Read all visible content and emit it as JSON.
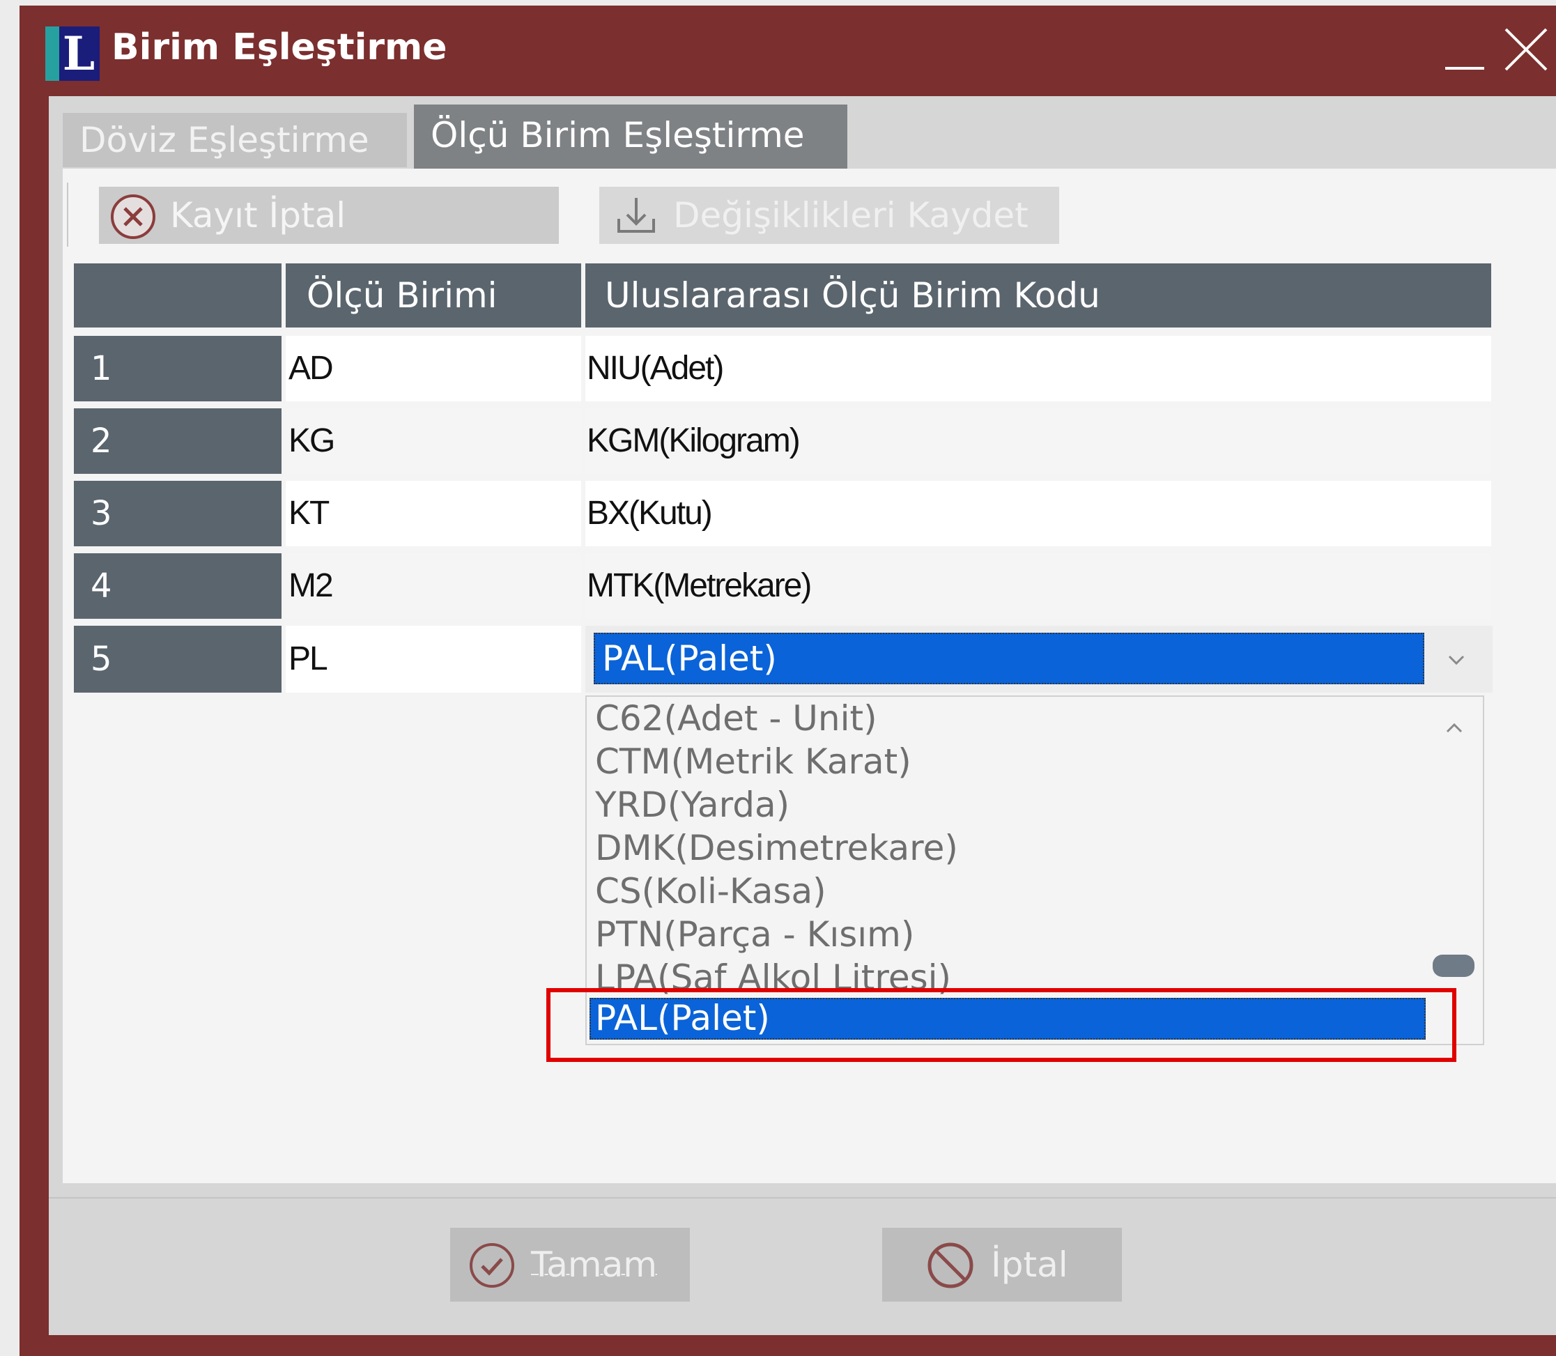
{
  "window": {
    "title": "Birim Eşleştirme",
    "logo_letter": "L",
    "minimize_icon": "minimize-icon",
    "close_icon": "close-icon"
  },
  "tabs": [
    {
      "label": "Döviz Eşleştirme",
      "active": false
    },
    {
      "label": "Ölçü Birim Eşleştirme",
      "active": true
    }
  ],
  "toolbar": {
    "cancel_record_label": "Kayıt İptal",
    "cancel_record_icon": "cancel-circle-icon",
    "save_changes_label": "Değişiklikleri Kaydet",
    "save_changes_icon": "download-icon",
    "save_changes_enabled": false
  },
  "grid": {
    "columns": [
      "",
      "Ölçü Birimi",
      "Uluslararası Ölçü Birim Kodu"
    ],
    "rows": [
      {
        "num": "1",
        "unit": "AD",
        "code": "NIU(Adet)"
      },
      {
        "num": "2",
        "unit": "KG",
        "code": "KGM(Kilogram)"
      },
      {
        "num": "3",
        "unit": "KT",
        "code": "BX(Kutu)"
      },
      {
        "num": "4",
        "unit": "M2",
        "code": "MTK(Metrekare)"
      },
      {
        "num": "5",
        "unit": "PL",
        "code": "PAL(Palet)"
      }
    ]
  },
  "dropdown": {
    "items": [
      "C62(Adet - Unit)",
      "CTM(Metrik Karat)",
      "YRD(Yarda)",
      "DMK(Desimetrekare)",
      "CS(Koli-Kasa)",
      "PTN(Parça - Kısım)",
      "LPA(Saf Alkol Litresi)",
      "PAL(Palet)"
    ],
    "selected": "PAL(Palet)",
    "highlight_color": "#e00000"
  },
  "footer": {
    "ok_label": "Tamam",
    "ok_icon": "check-circle-icon",
    "cancel_label": "İptal",
    "cancel_icon": "prohibited-icon"
  },
  "colors": {
    "frame": "#7b2f2e",
    "grid_header": "#5b656e",
    "selection": "#0a63d8"
  }
}
